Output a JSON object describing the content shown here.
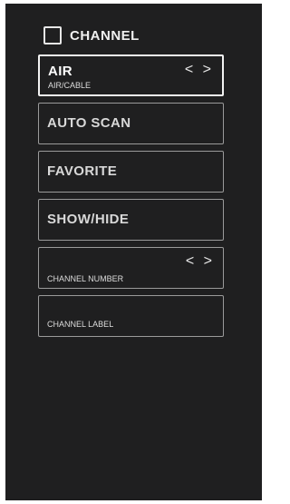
{
  "header": {
    "title": "CHANNEL",
    "icon": "checkbox-square-icon"
  },
  "menu": {
    "items": [
      {
        "title": "AIR",
        "subtitle": "AIR/CABLE",
        "arrows": "< >"
      },
      {
        "title": "AUTO SCAN"
      },
      {
        "title": "FAVORITE"
      },
      {
        "title": "SHOW/HIDE"
      },
      {
        "subtitle": "CHANNEL NUMBER",
        "arrows": "< >"
      },
      {
        "subtitle": "CHANNEL LABEL"
      }
    ]
  },
  "colors": {
    "background": "#1f1f20",
    "border": "#9a9a9a",
    "selected_border": "#f2f2f2",
    "text": "#d8d8d8"
  }
}
